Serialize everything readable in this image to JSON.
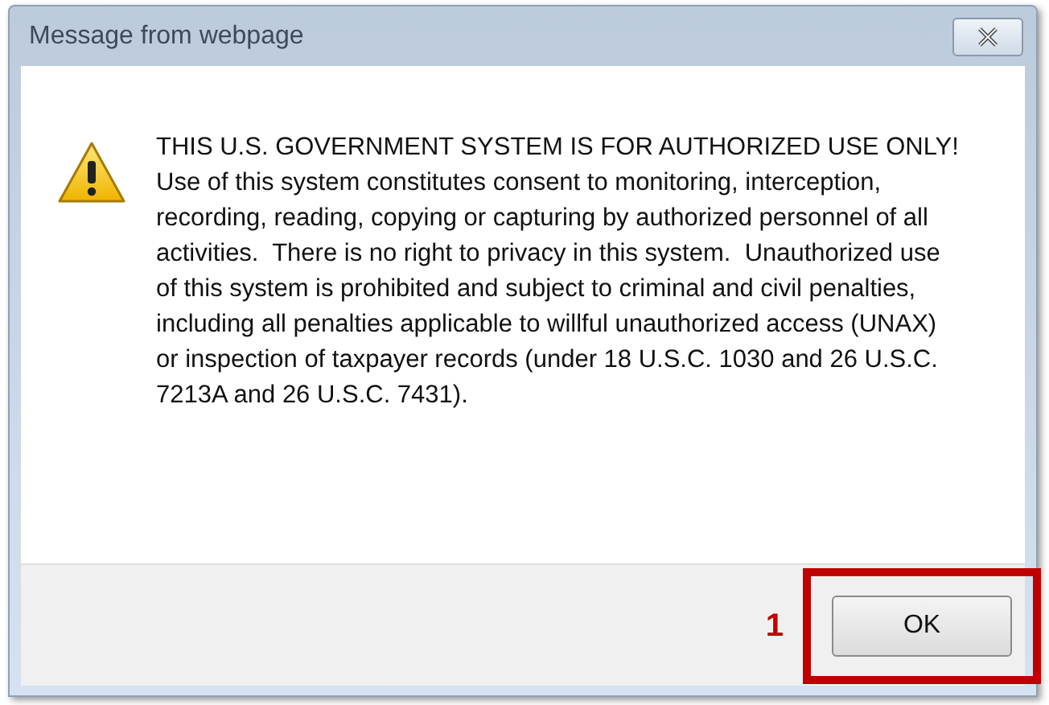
{
  "window": {
    "title": "Message from webpage"
  },
  "message": {
    "heading": "THIS U.S. GOVERNMENT SYSTEM IS FOR AUTHORIZED USE ONLY!",
    "body": "Use of this system constitutes consent to monitoring, interception, recording, reading, copying or capturing by authorized personnel of all activities.  There is no right to privacy in this system.  Unauthorized use of this system is prohibited and subject to criminal and civil penalties, including all penalties applicable to willful unauthorized access (UNAX) or inspection of taxpayer records (under 18 U.S.C. 1030 and 26 U.S.C. 7213A and 26 U.S.C. 7431)."
  },
  "buttons": [
    "OK"
  ],
  "callout": {
    "number": "1"
  }
}
